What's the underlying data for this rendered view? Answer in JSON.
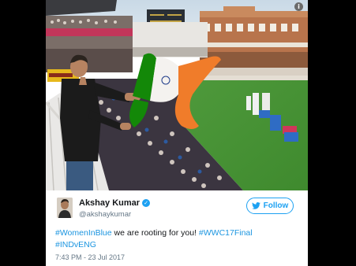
{
  "photo": {
    "alt": "Akshay Kumar waving Indian flag at Lord's cricket ground",
    "info_glyph": "i"
  },
  "tweet": {
    "display_name": "Akshay Kumar",
    "verified_glyph": "✓",
    "handle": "@akshaykumar",
    "follow_label": "Follow",
    "hashtag1": "#WomenInBlue",
    "text_mid": " we are rooting for you! ",
    "hashtag2": "#WWC17Final",
    "hashtag3": "#INDvENG",
    "timestamp": "7:43 PM - 23 Jul 2017"
  },
  "colors": {
    "twitter_blue": "#1da1f2",
    "hashtag_blue": "#1b95e0",
    "saffron": "#f07c2a",
    "flag_green": "#138808"
  }
}
